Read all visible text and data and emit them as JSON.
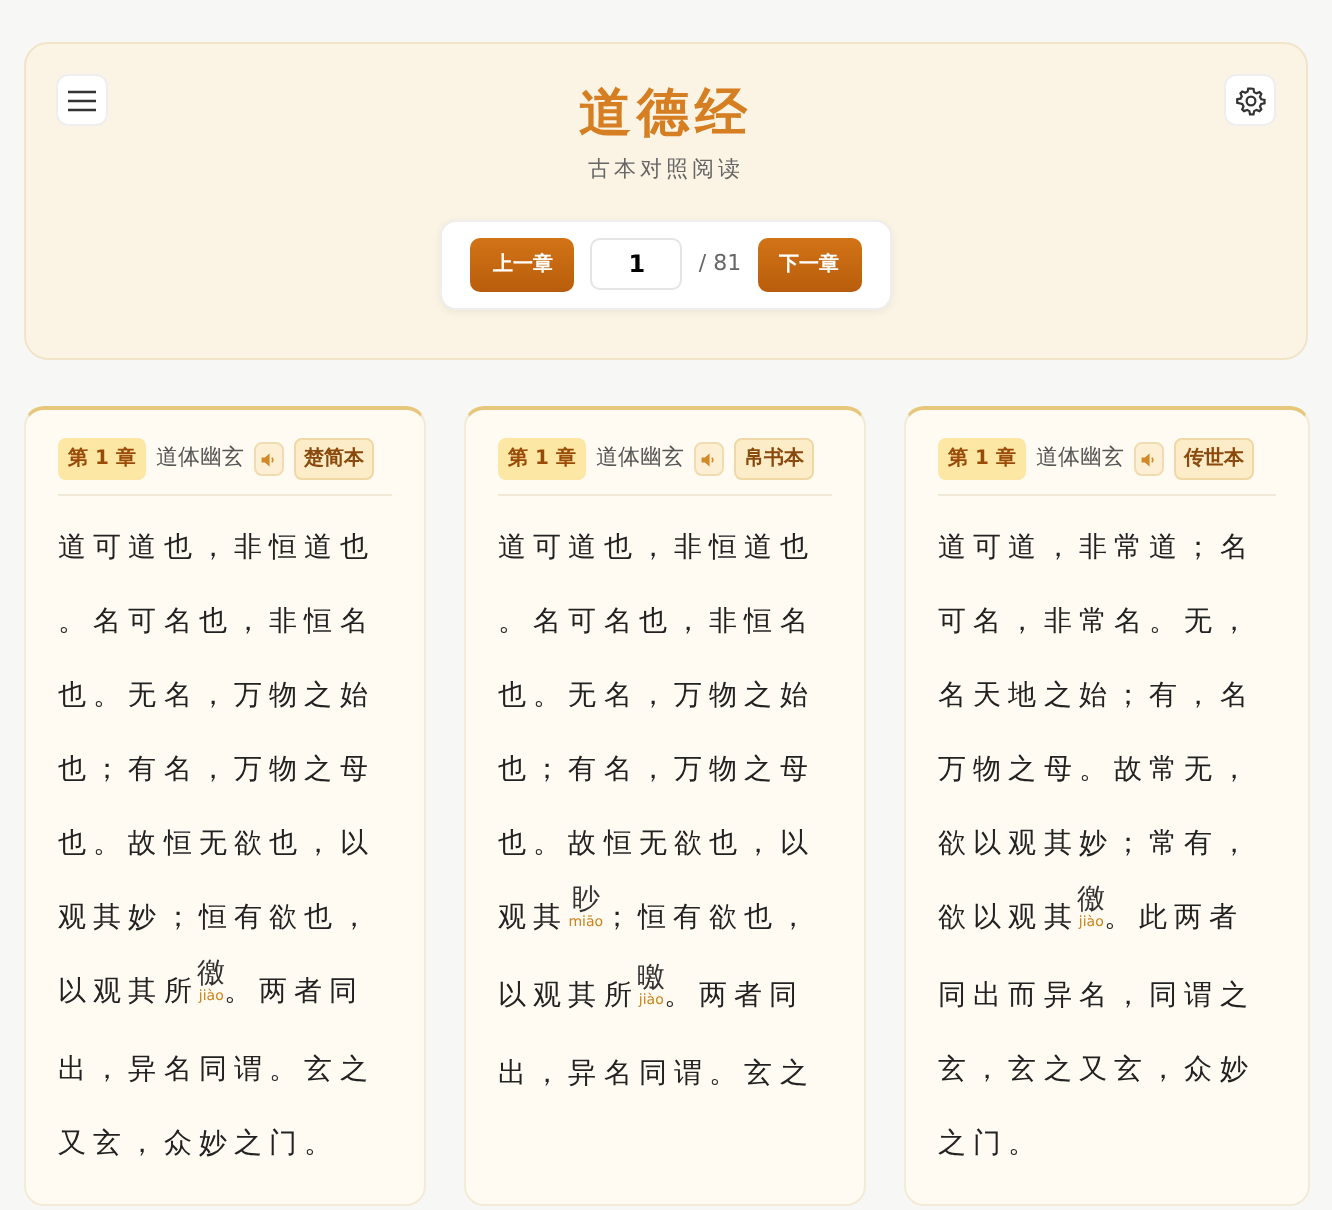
{
  "header": {
    "title": "道德经",
    "subtitle": "古本对照阅读"
  },
  "pager": {
    "prev": "上一章",
    "chapter": "1",
    "total": "/ 81",
    "next": "下一章"
  },
  "columns": [
    {
      "chapter": "第 1 章",
      "chapter_title": "道体幽玄",
      "version": "楚简本",
      "segments": [
        {
          "kind": "text",
          "text": "道可道也，非恒道也。名可名也，非恒名也。无名，万物之始也；有名，万物之母也。故恒无欲也，以观其妙；恒有欲也，以观其所"
        },
        {
          "kind": "annotation",
          "char": "徼",
          "pinyin": "jiào"
        },
        {
          "kind": "text",
          "text": "。两者同出，异名同谓。玄之又玄，众妙之门。"
        }
      ]
    },
    {
      "chapter": "第 1 章",
      "chapter_title": "道体幽玄",
      "version": "帛书本",
      "segments": [
        {
          "kind": "text",
          "text": "道可道也，非恒道也。名可名也，非恒名也。无名，万物之始也；有名，万物之母也。故恒无欲也，以观其"
        },
        {
          "kind": "annotation",
          "char": "眇",
          "pinyin": "miāo"
        },
        {
          "kind": "text",
          "text": "；恒有欲也，以观其所"
        },
        {
          "kind": "annotation",
          "char": "曒",
          "pinyin": "jiào"
        },
        {
          "kind": "text",
          "text": "。两者同出，异名同谓。玄之"
        }
      ]
    },
    {
      "chapter": "第 1 章",
      "chapter_title": "道体幽玄",
      "version": "传世本",
      "segments": [
        {
          "kind": "text",
          "text": "道可道，非常道；名可名，非常名。无，名天地之始；有，名万物之母。故常无，欲以观其妙；常有，欲以观其"
        },
        {
          "kind": "annotation",
          "char": "徼",
          "pinyin": "jiào"
        },
        {
          "kind": "text",
          "text": "。此两者同出而异名，同谓之玄，玄之又玄，众妙之门。"
        }
      ]
    }
  ]
}
